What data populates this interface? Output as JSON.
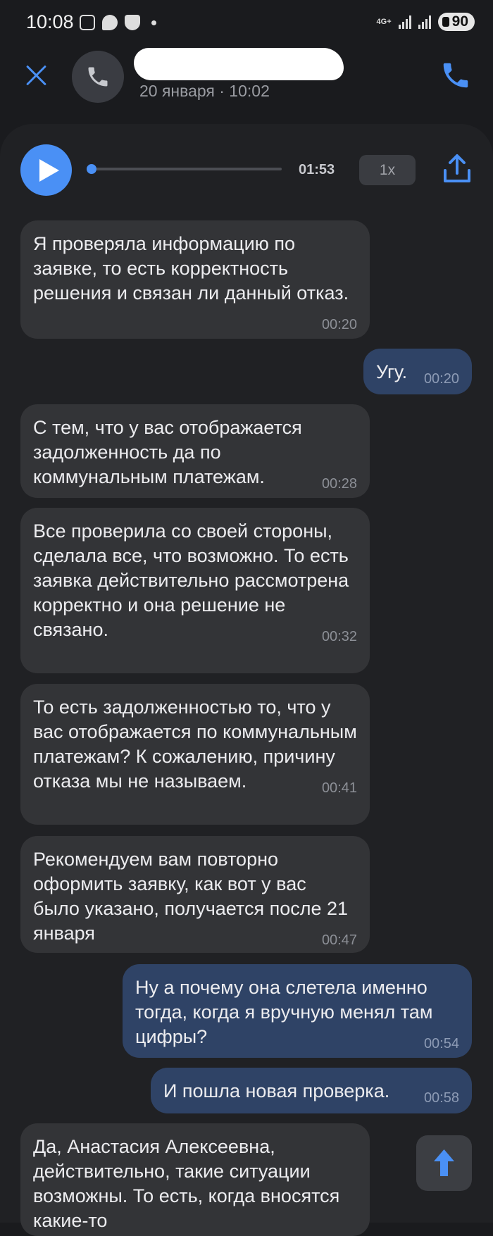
{
  "status_bar": {
    "time": "10:08",
    "network": "4G+",
    "battery": "90"
  },
  "header": {
    "date_time": "20 января · 10:02"
  },
  "player": {
    "duration": "01:53",
    "speed": "1x",
    "progress": 0.0
  },
  "messages": [
    {
      "dir": "in",
      "text": "Я проверяла информацию по заявке, то есть корректность решения и связан ли данный отказ.",
      "time": "00:20"
    },
    {
      "dir": "out",
      "text": "Угу.",
      "time": "00:20"
    },
    {
      "dir": "in",
      "text": "С тем, что у вас отображается задолженность да по коммунальным платежам.",
      "time": "00:28"
    },
    {
      "dir": "in",
      "text": "Все проверила со своей стороны, сделала все, что возможно. То есть заявка действительно рассмотрена корректно и она решение не связано.",
      "time": "00:32"
    },
    {
      "dir": "in",
      "text": "То есть задолженностью то, что у вас отображается по коммунальным платежам? К сожалению, причину отказа мы не называем.",
      "time": "00:41"
    },
    {
      "dir": "in",
      "text": "Рекомендуем вам повторно оформить заявку, как вот у вас было указано, получается после 21 января",
      "time": "00:47"
    },
    {
      "dir": "out",
      "text": "Ну а почему она слетела именно тогда, когда я вручную менял там цифры?",
      "time": "00:54"
    },
    {
      "dir": "out",
      "text": "И пошла новая проверка.",
      "time": "00:58"
    },
    {
      "dir": "in",
      "text": "Да, Анастасия Алексеевна, действительно, такие ситуации возможны. То есть, когда вносятся какие-то",
      "time": ""
    }
  ],
  "colors": {
    "accent": "#4a90f5",
    "incoming_bubble": "#333437",
    "outgoing_bubble": "#2f4366",
    "background": "#1a1b1e"
  },
  "icons": {
    "close": "close-icon",
    "phone": "phone-icon",
    "share": "upload-icon",
    "scroll": "arrow-up-icon"
  }
}
